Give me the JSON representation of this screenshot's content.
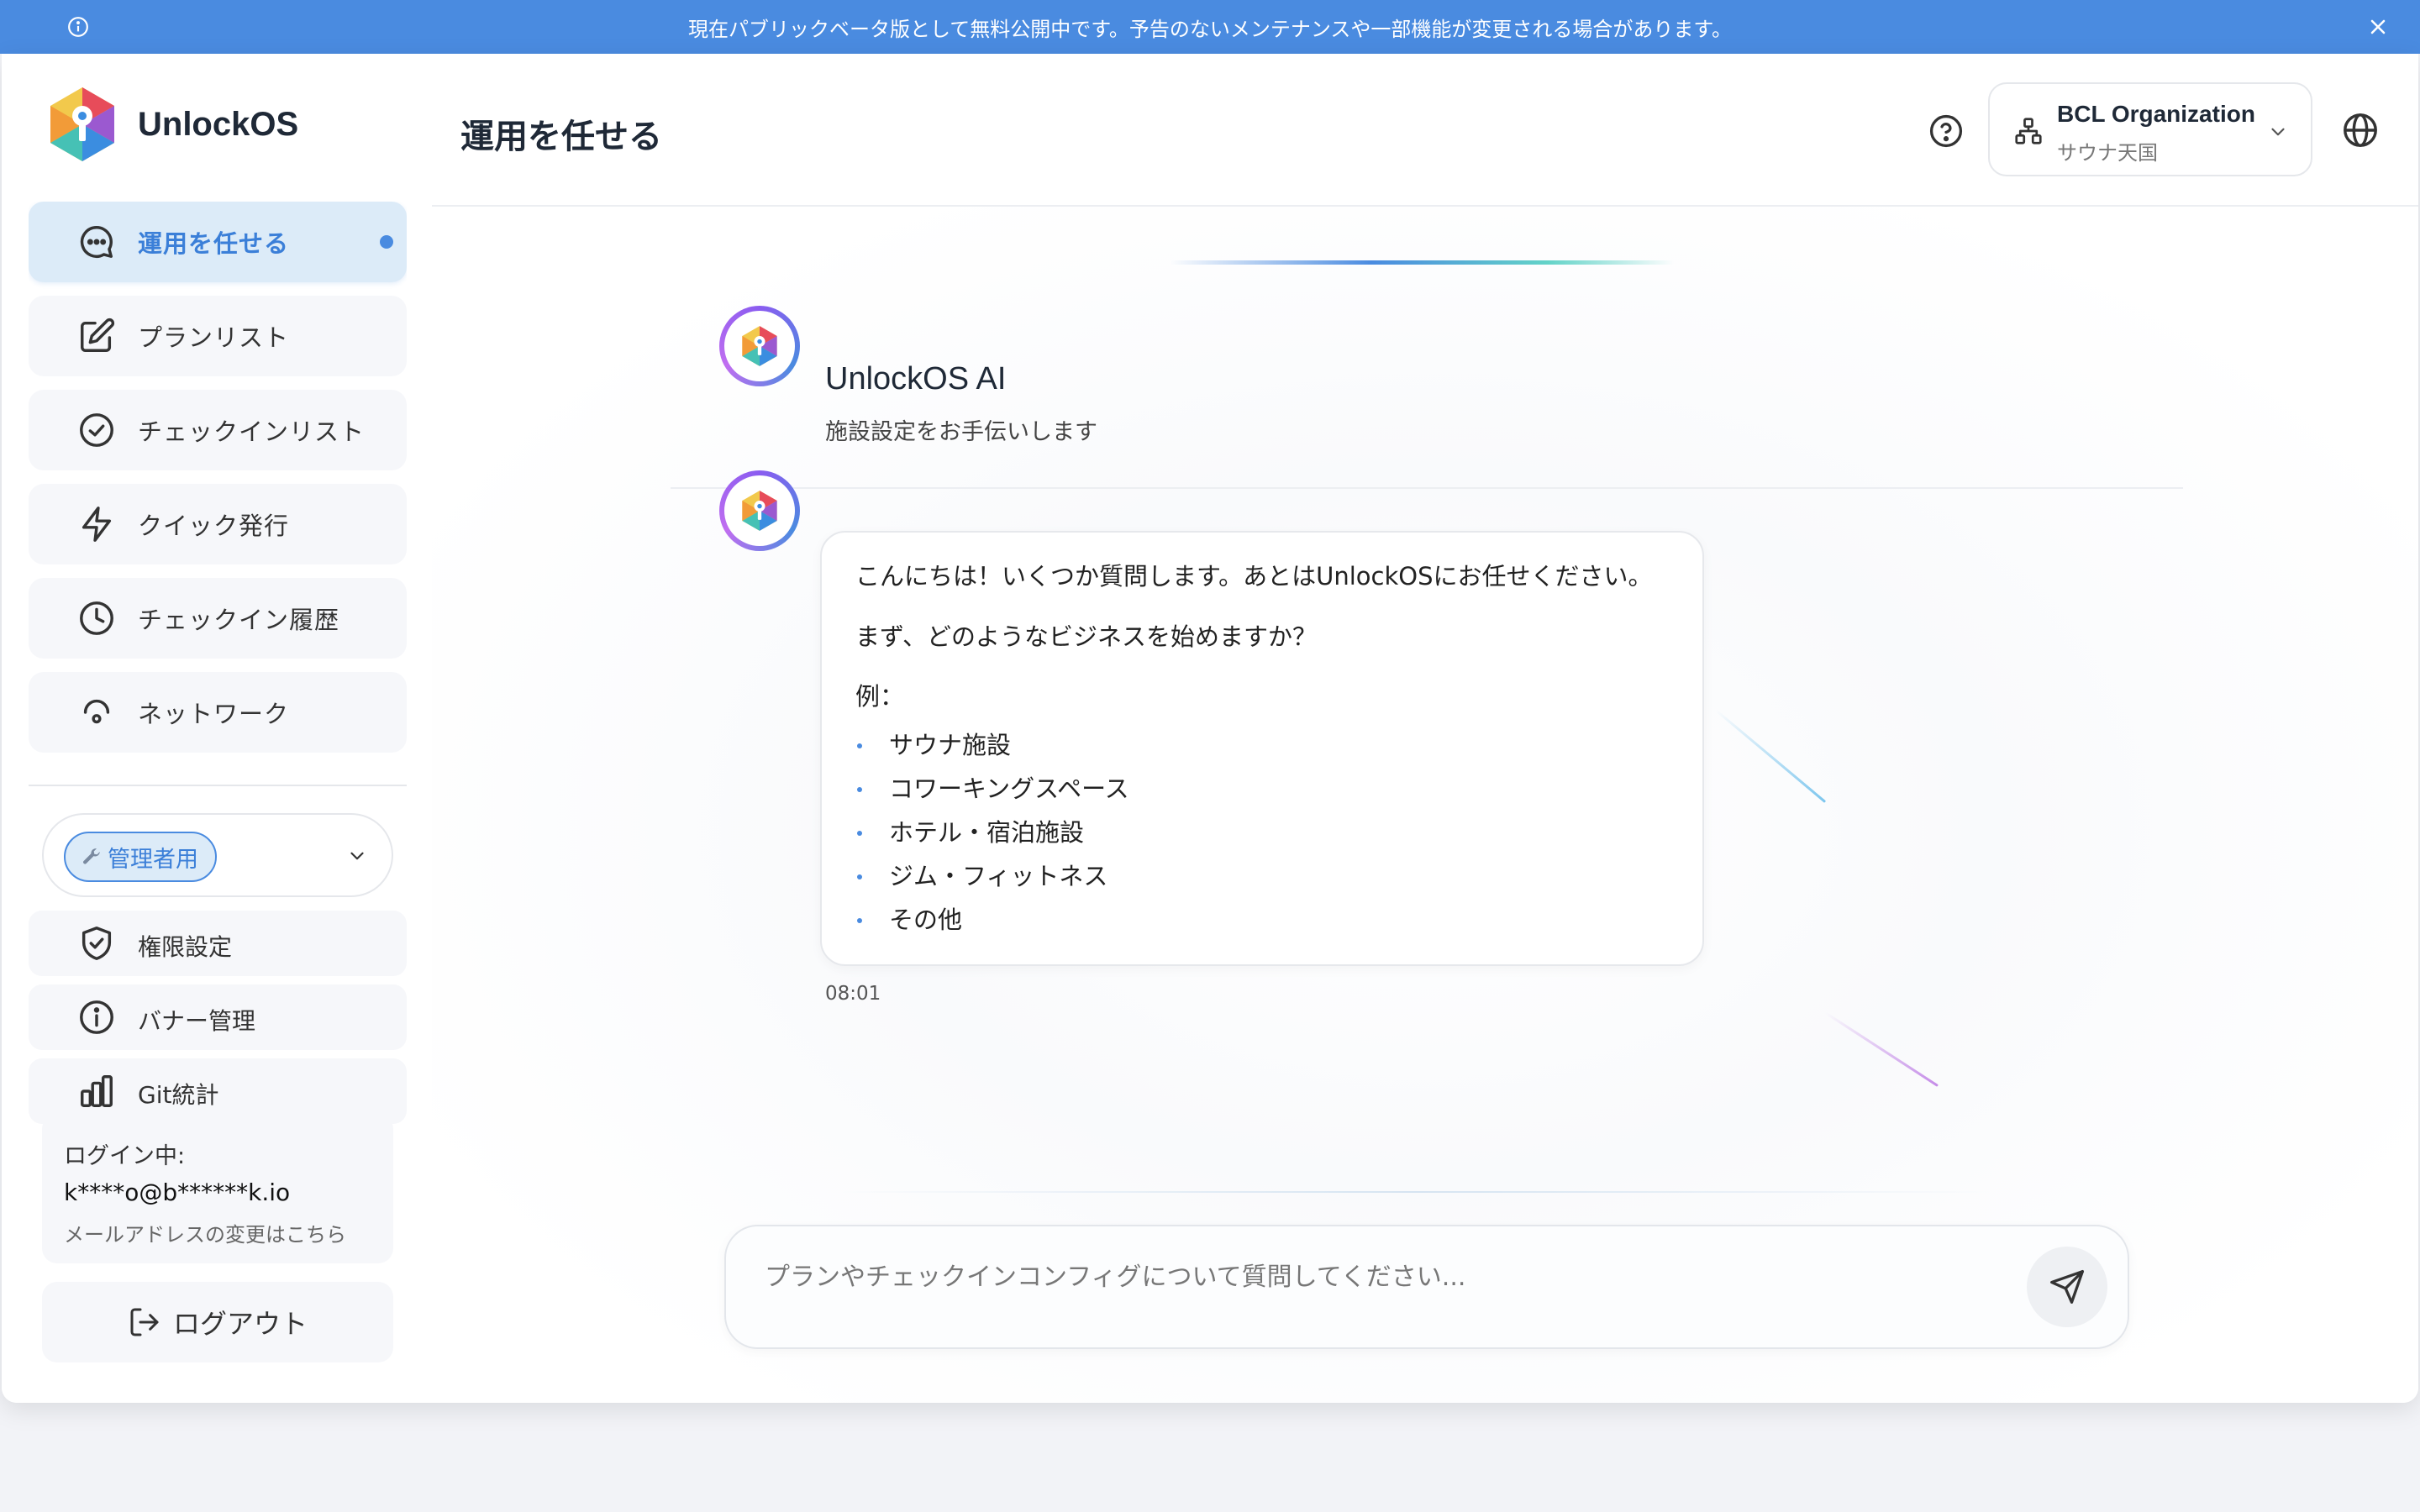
{
  "banner": {
    "message": "現在パブリックベータ版として無料公開中です。予告のないメンテナンスや一部機能が変更される場合があります。"
  },
  "app": {
    "name": "UnlockOS"
  },
  "sidebar": {
    "nav_items": [
      {
        "label": "運用を任せる",
        "icon": "chat-bubble-icon",
        "active": true
      },
      {
        "label": "プランリスト",
        "icon": "edit-icon"
      },
      {
        "label": "チェックインリスト",
        "icon": "check-circle-icon"
      },
      {
        "label": "クイック発行",
        "icon": "lightning-icon"
      },
      {
        "label": "チェックイン履歴",
        "icon": "clock-icon"
      },
      {
        "label": "ネットワーク",
        "icon": "network-icon"
      }
    ],
    "role_select": {
      "label": "管理者用"
    },
    "admin_items": [
      {
        "label": "権限設定",
        "icon": "shield-check-icon"
      },
      {
        "label": "バナー管理",
        "icon": "info-circle-icon"
      },
      {
        "label": "Git統計",
        "icon": "bar-chart-icon"
      }
    ],
    "login": {
      "label": "ログイン中:",
      "email": "k****o@b******k.io",
      "change_email": "メールアドレスの変更はこちら"
    },
    "logout_label": "ログアウト"
  },
  "header": {
    "title": "運用を任せる",
    "org_name": "BCL Organization",
    "org_sub": "サウナ天国"
  },
  "chat": {
    "ai_name": "UnlockOS AI",
    "ai_subtitle": "施設設定をお手伝いします",
    "message": {
      "line1": "こんにちは！いくつか質問します。あとはUnlockOSにお任せください。",
      "line2": "まず、どのようなビジネスを始めますか？",
      "examples_label": "例：",
      "examples": [
        "サウナ施設",
        "コワーキングスペース",
        "ホテル・宿泊施設",
        "ジム・フィットネス",
        "その他"
      ],
      "time": "08:01"
    },
    "input_placeholder": "プランやチェックインコンフィグについて質問してください...",
    "input_value": ""
  },
  "colors": {
    "accent": "#4a8be0",
    "banner_bg": "#4a8be0",
    "active_nav_bg": "#dcebf8"
  }
}
